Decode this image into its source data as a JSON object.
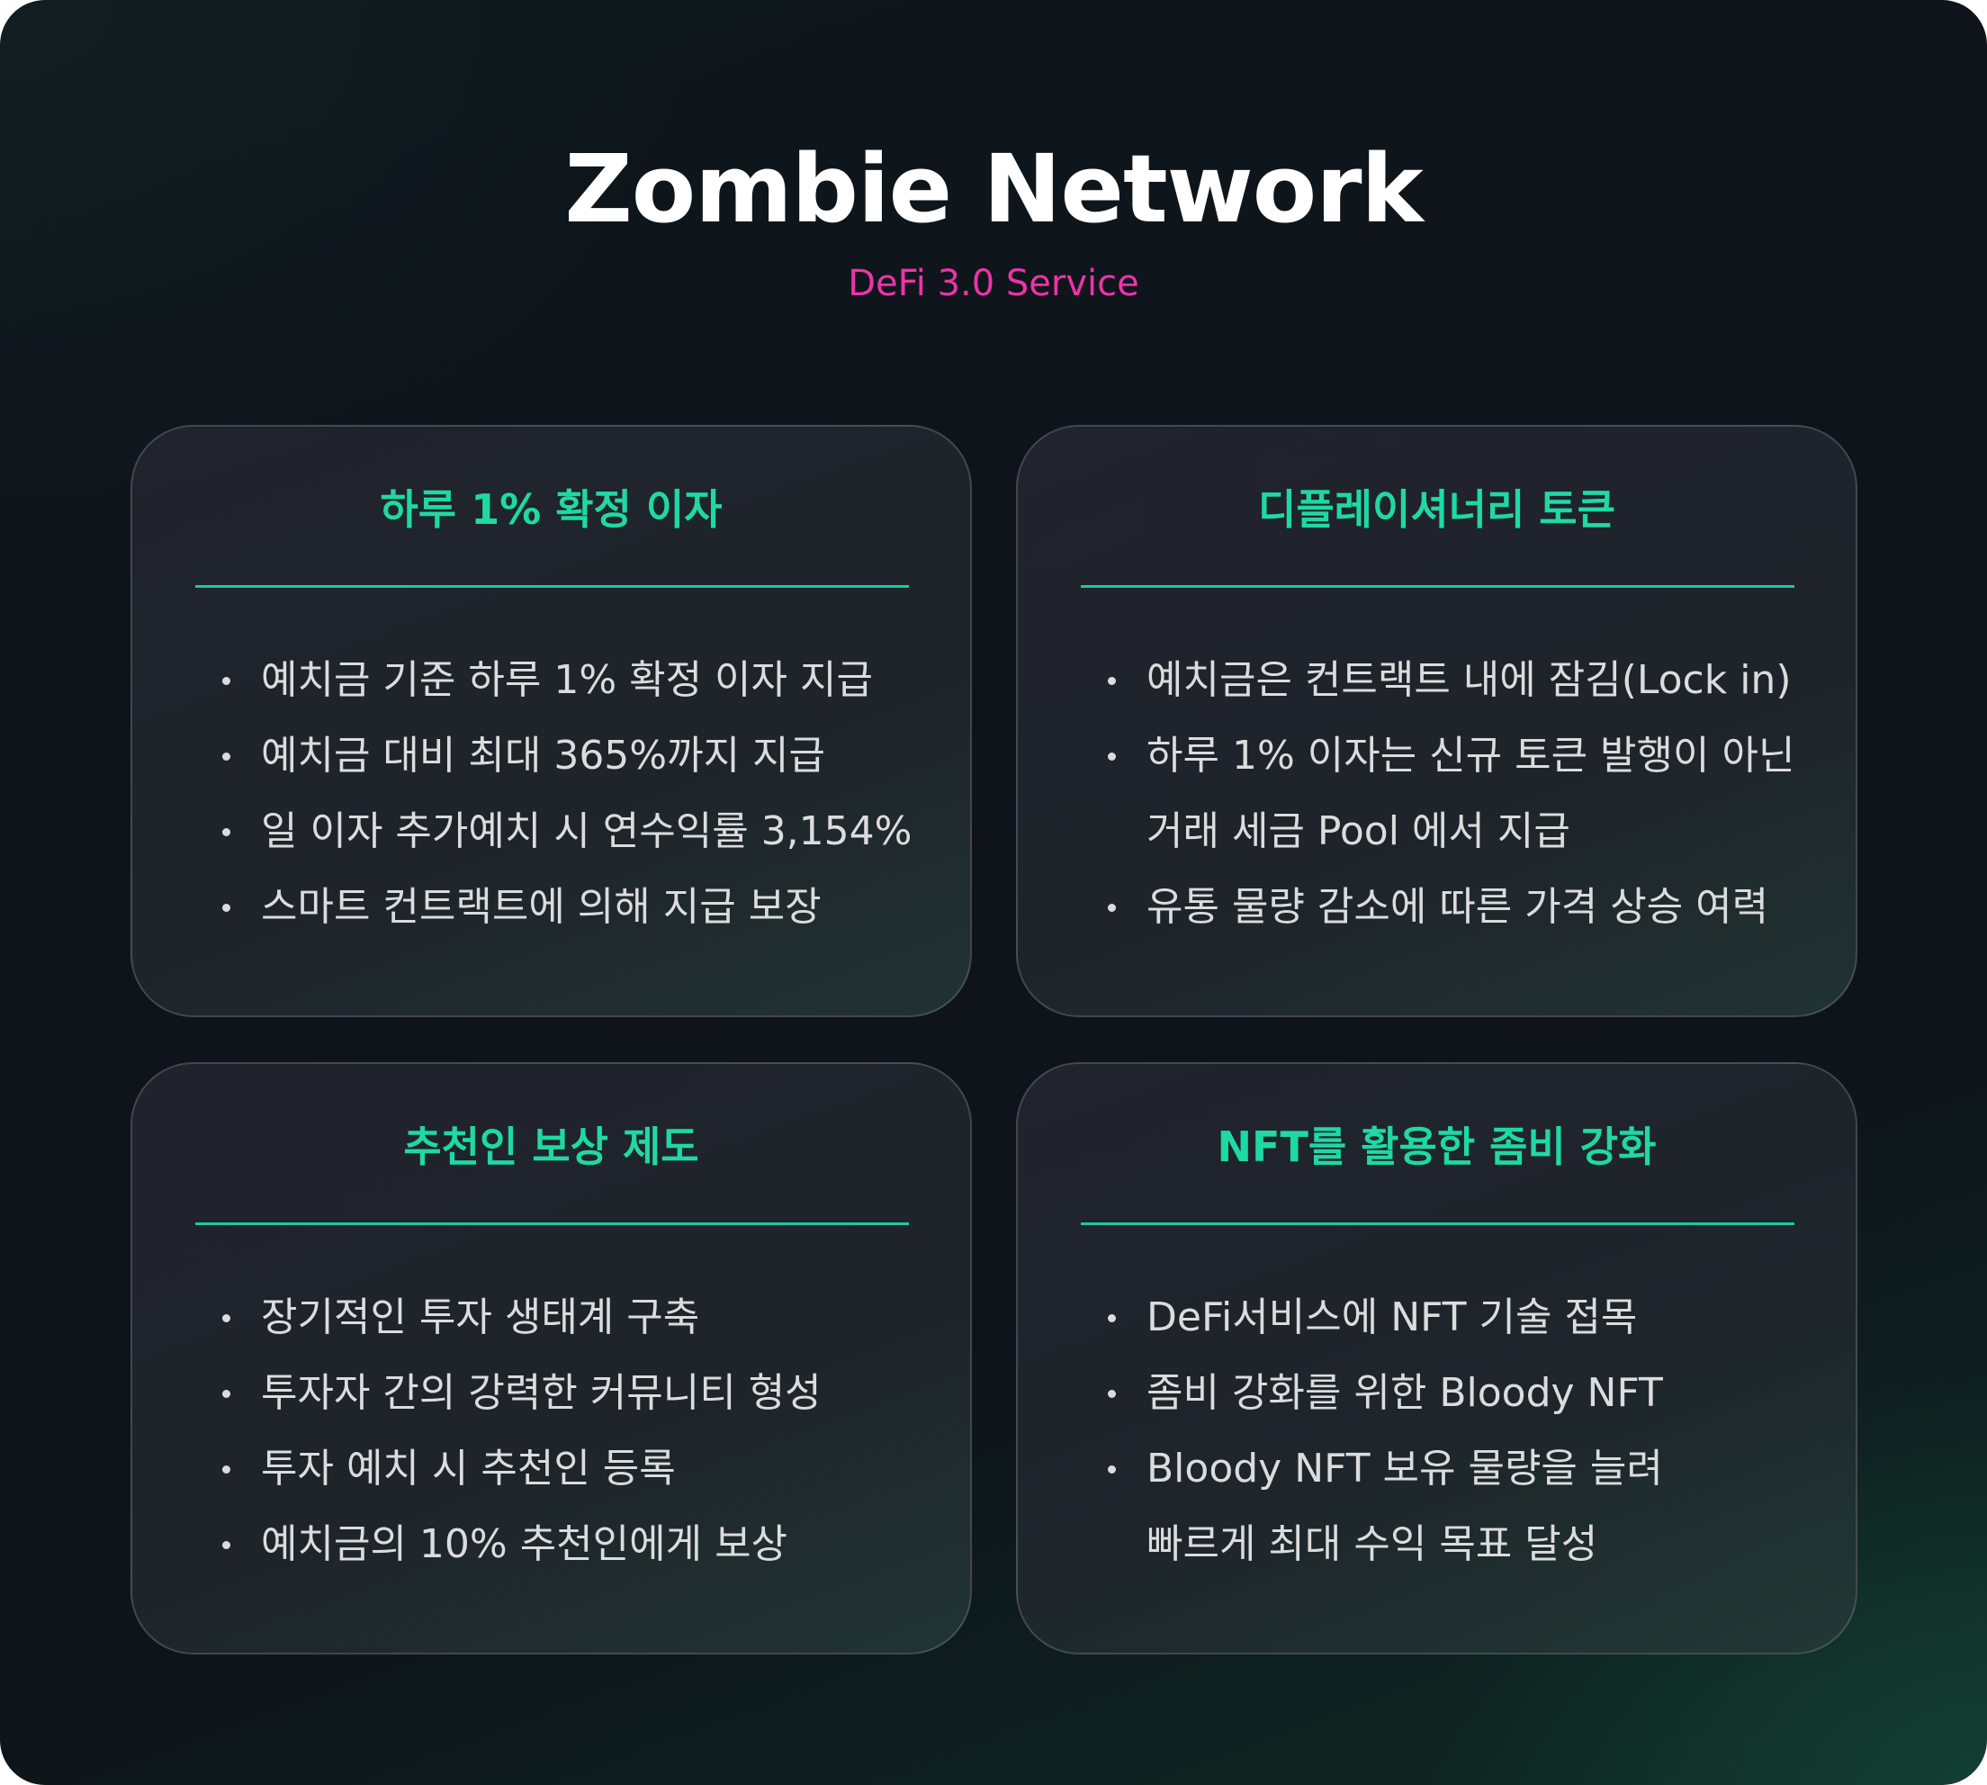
{
  "header": {
    "title": "Zombie Network",
    "subtitle": "DeFi 3.0 Service"
  },
  "cards": [
    {
      "title": "하루 1% 확정 이자",
      "lines": [
        {
          "text": "예치금 기준 하루 1% 확정 이자 지급",
          "bullet": true
        },
        {
          "text": "예치금 대비 최대 365%까지 지급",
          "bullet": true
        },
        {
          "text": "일 이자 추가예치 시 연수익률 3,154%",
          "bullet": true
        },
        {
          "text": "스마트 컨트랙트에 의해 지급 보장",
          "bullet": true
        }
      ]
    },
    {
      "title": "디플레이셔너리 토큰",
      "lines": [
        {
          "text": "예치금은 컨트랙트 내에 잠김(Lock in)",
          "bullet": true
        },
        {
          "text": "하루 1% 이자는 신규 토큰 발행이 아닌",
          "bullet": true
        },
        {
          "text": "거래 세금 Pool 에서 지급",
          "bullet": false
        },
        {
          "text": "유통 물량 감소에 따른 가격 상승 여력",
          "bullet": true
        }
      ]
    },
    {
      "title": "추천인 보상 제도",
      "lines": [
        {
          "text": "장기적인 투자 생태계 구축",
          "bullet": true
        },
        {
          "text": "투자자 간의 강력한 커뮤니티 형성",
          "bullet": true
        },
        {
          "text": "투자 예치 시 추천인 등록",
          "bullet": true
        },
        {
          "text": "예치금의 10% 추천인에게 보상",
          "bullet": true
        }
      ]
    },
    {
      "title": "NFT를 활용한 좀비 강화",
      "lines": [
        {
          "text": "DeFi서비스에 NFT 기술 접목",
          "bullet": true
        },
        {
          "text": "좀비 강화를 위한 Bloody NFT",
          "bullet": true
        },
        {
          "text": "Bloody NFT 보유 물량을 늘려",
          "bullet": true
        },
        {
          "text": "빠르게 최대 수익 목표 달성",
          "bullet": false
        }
      ]
    }
  ],
  "colors": {
    "accent_green": "#1fd9a3",
    "subtitle_pink": "#ee33a8",
    "background": "#0f131a",
    "body_text": "#dcdcdc"
  }
}
